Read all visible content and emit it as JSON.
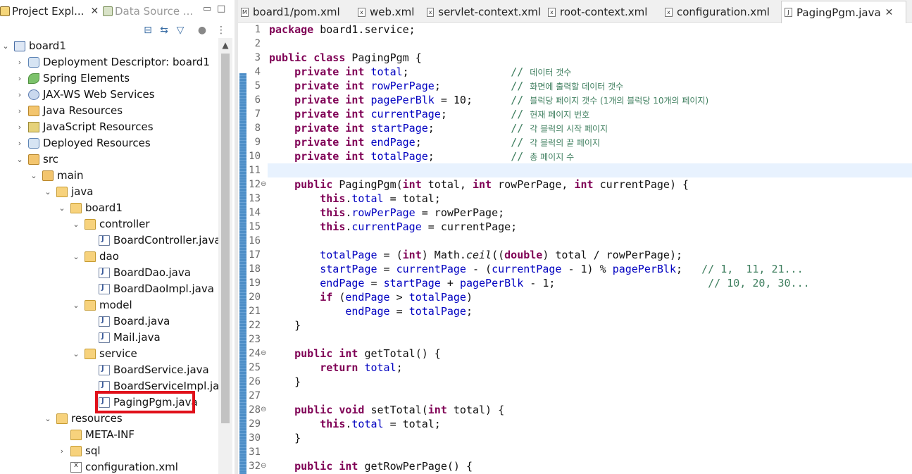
{
  "left_panel": {
    "tabs": [
      {
        "label": "Project Expl...",
        "active": true
      },
      {
        "label": "Data Source ...",
        "active": false
      }
    ]
  },
  "tree": [
    {
      "label": "board1",
      "icon": "project-icon",
      "depth": 0,
      "expanded": true
    },
    {
      "label": "Deployment Descriptor: board1",
      "icon": "deployment-descriptor-icon",
      "depth": 1,
      "expanded": false
    },
    {
      "label": "Spring Elements",
      "icon": "spring-icon",
      "depth": 1,
      "expanded": false
    },
    {
      "label": "JAX-WS Web Services",
      "icon": "web-services-icon",
      "depth": 1,
      "expanded": false
    },
    {
      "label": "Java Resources",
      "icon": "java-resources-icon",
      "depth": 1,
      "expanded": false
    },
    {
      "label": "JavaScript Resources",
      "icon": "javascript-resources-icon",
      "depth": 1,
      "expanded": false
    },
    {
      "label": "Deployed Resources",
      "icon": "deployed-resources-icon",
      "depth": 1,
      "expanded": false
    },
    {
      "label": "src",
      "icon": "source-folder-icon",
      "depth": 1,
      "expanded": true
    },
    {
      "label": "main",
      "icon": "source-folder-icon",
      "depth": 2,
      "expanded": true
    },
    {
      "label": "java",
      "icon": "folder-icon",
      "depth": 3,
      "expanded": true
    },
    {
      "label": "board1",
      "icon": "folder-icon",
      "depth": 4,
      "expanded": true
    },
    {
      "label": "controller",
      "icon": "folder-icon",
      "depth": 5,
      "expanded": true
    },
    {
      "label": "BoardController.java",
      "icon": "java-file-icon",
      "depth": 6,
      "expanded": null
    },
    {
      "label": "dao",
      "icon": "folder-icon",
      "depth": 5,
      "expanded": true
    },
    {
      "label": "BoardDao.java",
      "icon": "java-file-icon",
      "depth": 6,
      "expanded": null
    },
    {
      "label": "BoardDaoImpl.java",
      "icon": "java-file-icon",
      "depth": 6,
      "expanded": null
    },
    {
      "label": "model",
      "icon": "folder-icon",
      "depth": 5,
      "expanded": true
    },
    {
      "label": "Board.java",
      "icon": "java-file-icon",
      "depth": 6,
      "expanded": null
    },
    {
      "label": "Mail.java",
      "icon": "java-file-icon",
      "depth": 6,
      "expanded": null
    },
    {
      "label": "service",
      "icon": "folder-icon",
      "depth": 5,
      "expanded": true
    },
    {
      "label": "BoardService.java",
      "icon": "java-file-icon",
      "depth": 6,
      "expanded": null
    },
    {
      "label": "BoardServiceImpl.java",
      "icon": "java-file-icon",
      "depth": 6,
      "expanded": null
    },
    {
      "label": "PagingPgm.java",
      "icon": "java-file-icon",
      "depth": 6,
      "expanded": null,
      "selected": true
    },
    {
      "label": "resources",
      "icon": "folder-icon",
      "depth": 3,
      "expanded": true
    },
    {
      "label": "META-INF",
      "icon": "folder-icon",
      "depth": 4,
      "expanded": null
    },
    {
      "label": "sql",
      "icon": "folder-icon",
      "depth": 4,
      "expanded": false
    },
    {
      "label": "configuration.xml",
      "icon": "xml-file-icon",
      "depth": 4,
      "expanded": null
    }
  ],
  "editor": {
    "tabs": [
      {
        "label": "board1/pom.xml",
        "icon": "maven-file-icon",
        "active": false
      },
      {
        "label": "web.xml",
        "icon": "xml-file-icon",
        "active": false
      },
      {
        "label": "servlet-context.xml",
        "icon": "xml-file-icon",
        "active": false
      },
      {
        "label": "root-context.xml",
        "icon": "xml-file-icon",
        "active": false
      },
      {
        "label": "configuration.xml",
        "icon": "xml-file-icon",
        "active": false
      },
      {
        "label": "PagingPgm.java",
        "icon": "java-file-icon",
        "active": true
      }
    ],
    "current_line": 11,
    "lines": [
      {
        "n": "1",
        "fold": false,
        "tokens": [
          [
            "kw",
            "package"
          ],
          [
            "p",
            " board1.service;"
          ]
        ]
      },
      {
        "n": "2",
        "fold": false,
        "tokens": []
      },
      {
        "n": "3",
        "fold": false,
        "tokens": [
          [
            "kw",
            "public"
          ],
          [
            "p",
            " "
          ],
          [
            "kw",
            "class"
          ],
          [
            "p",
            " PagingPgm {"
          ]
        ]
      },
      {
        "n": "4",
        "fold": false,
        "tokens": [
          [
            "p",
            "    "
          ],
          [
            "kw",
            "private"
          ],
          [
            "p",
            " "
          ],
          [
            "kw",
            "int"
          ],
          [
            "p",
            " "
          ],
          [
            "fd",
            "total"
          ],
          [
            "p",
            ";                "
          ],
          [
            "cm",
            "// "
          ],
          [
            "cmk",
            "데이터 갯수"
          ]
        ]
      },
      {
        "n": "5",
        "fold": false,
        "tokens": [
          [
            "p",
            "    "
          ],
          [
            "kw",
            "private"
          ],
          [
            "p",
            " "
          ],
          [
            "kw",
            "int"
          ],
          [
            "p",
            " "
          ],
          [
            "fd",
            "rowPerPage"
          ],
          [
            "p",
            ";           "
          ],
          [
            "cm",
            "// "
          ],
          [
            "cmk",
            "화면에 출력할 데이터 갯수"
          ]
        ]
      },
      {
        "n": "6",
        "fold": false,
        "tokens": [
          [
            "p",
            "    "
          ],
          [
            "kw",
            "private"
          ],
          [
            "p",
            " "
          ],
          [
            "kw",
            "int"
          ],
          [
            "p",
            " "
          ],
          [
            "fd",
            "pagePerBlk"
          ],
          [
            "p",
            " = 10;      "
          ],
          [
            "cm",
            "// "
          ],
          [
            "cmk",
            "블럭당 페이지 갯수 (1개의 블럭당 10개의 페이지)"
          ]
        ]
      },
      {
        "n": "7",
        "fold": false,
        "tokens": [
          [
            "p",
            "    "
          ],
          [
            "kw",
            "private"
          ],
          [
            "p",
            " "
          ],
          [
            "kw",
            "int"
          ],
          [
            "p",
            " "
          ],
          [
            "fd",
            "currentPage"
          ],
          [
            "p",
            ";          "
          ],
          [
            "cm",
            "// "
          ],
          [
            "cmk",
            "현재 페이지 번호"
          ]
        ]
      },
      {
        "n": "8",
        "fold": false,
        "tokens": [
          [
            "p",
            "    "
          ],
          [
            "kw",
            "private"
          ],
          [
            "p",
            " "
          ],
          [
            "kw",
            "int"
          ],
          [
            "p",
            " "
          ],
          [
            "fd",
            "startPage"
          ],
          [
            "p",
            ";            "
          ],
          [
            "cm",
            "// "
          ],
          [
            "cmk",
            "각 블럭의 시작 페이지"
          ]
        ]
      },
      {
        "n": "9",
        "fold": false,
        "tokens": [
          [
            "p",
            "    "
          ],
          [
            "kw",
            "private"
          ],
          [
            "p",
            " "
          ],
          [
            "kw",
            "int"
          ],
          [
            "p",
            " "
          ],
          [
            "fd",
            "endPage"
          ],
          [
            "p",
            ";              "
          ],
          [
            "cm",
            "// "
          ],
          [
            "cmk",
            "각 블럭의 끝 페이지"
          ]
        ]
      },
      {
        "n": "10",
        "fold": false,
        "tokens": [
          [
            "p",
            "    "
          ],
          [
            "kw",
            "private"
          ],
          [
            "p",
            " "
          ],
          [
            "kw",
            "int"
          ],
          [
            "p",
            " "
          ],
          [
            "fd",
            "totalPage"
          ],
          [
            "p",
            ";            "
          ],
          [
            "cm",
            "// "
          ],
          [
            "cmk",
            "총 페이지 수"
          ]
        ]
      },
      {
        "n": "11",
        "fold": false,
        "tokens": []
      },
      {
        "n": "12",
        "fold": true,
        "tokens": [
          [
            "p",
            "    "
          ],
          [
            "kw",
            "public"
          ],
          [
            "p",
            " PagingPgm("
          ],
          [
            "kw",
            "int"
          ],
          [
            "p",
            " total, "
          ],
          [
            "kw",
            "int"
          ],
          [
            "p",
            " rowPerPage, "
          ],
          [
            "kw",
            "int"
          ],
          [
            "p",
            " currentPage) {"
          ]
        ]
      },
      {
        "n": "13",
        "fold": false,
        "tokens": [
          [
            "p",
            "        "
          ],
          [
            "kw",
            "this"
          ],
          [
            "p",
            "."
          ],
          [
            "fd",
            "total"
          ],
          [
            "p",
            " = total;"
          ]
        ]
      },
      {
        "n": "14",
        "fold": false,
        "tokens": [
          [
            "p",
            "        "
          ],
          [
            "kw",
            "this"
          ],
          [
            "p",
            "."
          ],
          [
            "fd",
            "rowPerPage"
          ],
          [
            "p",
            " = rowPerPage;"
          ]
        ]
      },
      {
        "n": "15",
        "fold": false,
        "tokens": [
          [
            "p",
            "        "
          ],
          [
            "kw",
            "this"
          ],
          [
            "p",
            "."
          ],
          [
            "fd",
            "currentPage"
          ],
          [
            "p",
            " = currentPage;"
          ]
        ]
      },
      {
        "n": "16",
        "fold": false,
        "tokens": []
      },
      {
        "n": "17",
        "fold": false,
        "tokens": [
          [
            "p",
            "        "
          ],
          [
            "fd",
            "totalPage"
          ],
          [
            "p",
            " = ("
          ],
          [
            "kw",
            "int"
          ],
          [
            "p",
            ") Math."
          ],
          [
            "it",
            "ceil"
          ],
          [
            "p",
            "(("
          ],
          [
            "kw",
            "double"
          ],
          [
            "p",
            ") total / rowPerPage);"
          ]
        ]
      },
      {
        "n": "18",
        "fold": false,
        "tokens": [
          [
            "p",
            "        "
          ],
          [
            "fd",
            "startPage"
          ],
          [
            "p",
            " = "
          ],
          [
            "fd",
            "currentPage"
          ],
          [
            "p",
            " - ("
          ],
          [
            "fd",
            "currentPage"
          ],
          [
            "p",
            " - 1) % "
          ],
          [
            "fd",
            "pagePerBlk"
          ],
          [
            "p",
            ";   "
          ],
          [
            "cm",
            "// 1,  11, 21..."
          ]
        ]
      },
      {
        "n": "19",
        "fold": false,
        "tokens": [
          [
            "p",
            "        "
          ],
          [
            "fd",
            "endPage"
          ],
          [
            "p",
            " = "
          ],
          [
            "fd",
            "startPage"
          ],
          [
            "p",
            " + "
          ],
          [
            "fd",
            "pagePerBlk"
          ],
          [
            "p",
            " - 1;                        "
          ],
          [
            "cm",
            "// 10, 20, 30..."
          ]
        ]
      },
      {
        "n": "20",
        "fold": false,
        "tokens": [
          [
            "p",
            "        "
          ],
          [
            "kw",
            "if"
          ],
          [
            "p",
            " ("
          ],
          [
            "fd",
            "endPage"
          ],
          [
            "p",
            " > "
          ],
          [
            "fd",
            "totalPage"
          ],
          [
            "p",
            ")"
          ]
        ]
      },
      {
        "n": "21",
        "fold": false,
        "tokens": [
          [
            "p",
            "            "
          ],
          [
            "fd",
            "endPage"
          ],
          [
            "p",
            " = "
          ],
          [
            "fd",
            "totalPage"
          ],
          [
            "p",
            ";"
          ]
        ]
      },
      {
        "n": "22",
        "fold": false,
        "tokens": [
          [
            "p",
            "    }"
          ]
        ]
      },
      {
        "n": "23",
        "fold": false,
        "tokens": []
      },
      {
        "n": "24",
        "fold": true,
        "tokens": [
          [
            "p",
            "    "
          ],
          [
            "kw",
            "public"
          ],
          [
            "p",
            " "
          ],
          [
            "kw",
            "int"
          ],
          [
            "p",
            " getTotal() {"
          ]
        ]
      },
      {
        "n": "25",
        "fold": false,
        "tokens": [
          [
            "p",
            "        "
          ],
          [
            "kw",
            "return"
          ],
          [
            "p",
            " "
          ],
          [
            "fd",
            "total"
          ],
          [
            "p",
            ";"
          ]
        ]
      },
      {
        "n": "26",
        "fold": false,
        "tokens": [
          [
            "p",
            "    }"
          ]
        ]
      },
      {
        "n": "27",
        "fold": false,
        "tokens": []
      },
      {
        "n": "28",
        "fold": true,
        "tokens": [
          [
            "p",
            "    "
          ],
          [
            "kw",
            "public"
          ],
          [
            "p",
            " "
          ],
          [
            "kw",
            "void"
          ],
          [
            "p",
            " setTotal("
          ],
          [
            "kw",
            "int"
          ],
          [
            "p",
            " total) {"
          ]
        ]
      },
      {
        "n": "29",
        "fold": false,
        "tokens": [
          [
            "p",
            "        "
          ],
          [
            "kw",
            "this"
          ],
          [
            "p",
            "."
          ],
          [
            "fd",
            "total"
          ],
          [
            "p",
            " = total;"
          ]
        ]
      },
      {
        "n": "30",
        "fold": false,
        "tokens": [
          [
            "p",
            "    }"
          ]
        ]
      },
      {
        "n": "31",
        "fold": false,
        "tokens": []
      },
      {
        "n": "32",
        "fold": true,
        "tokens": [
          [
            "p",
            "    "
          ],
          [
            "kw",
            "public"
          ],
          [
            "p",
            " "
          ],
          [
            "kw",
            "int"
          ],
          [
            "p",
            " getRowPerPage() {"
          ]
        ]
      }
    ]
  }
}
